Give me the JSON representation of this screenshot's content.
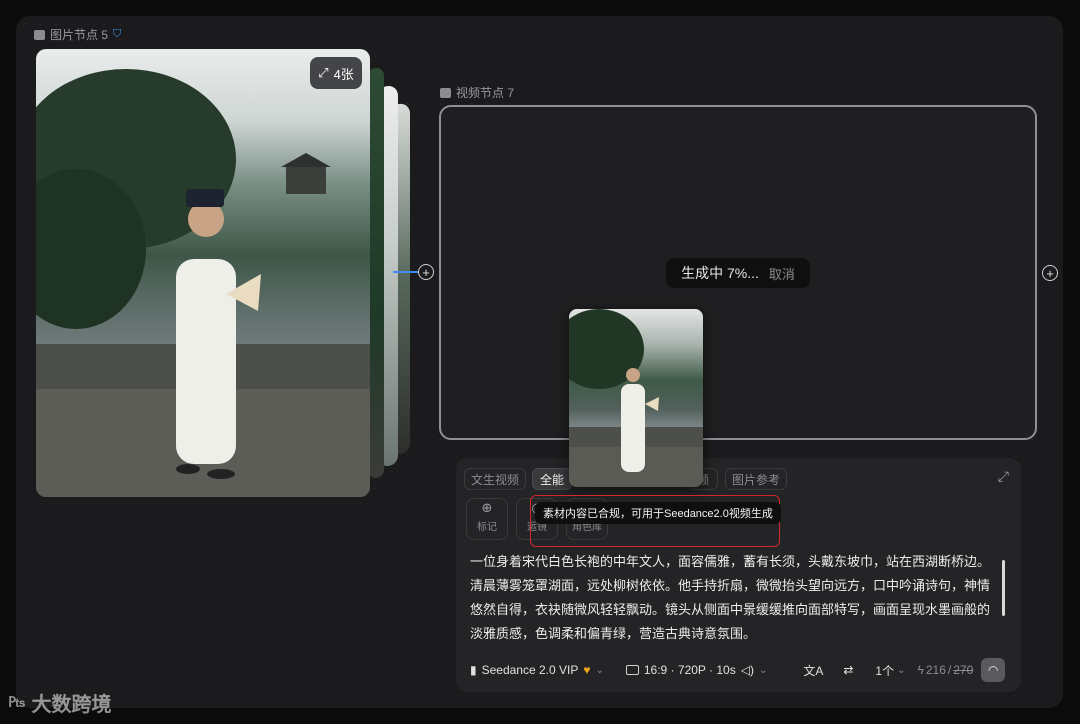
{
  "image_node": {
    "label": "图片节点 5",
    "expand_label": "4张"
  },
  "video_node": {
    "label": "视频节点 7"
  },
  "generation": {
    "status": "生成中 7%...",
    "cancel": "取消"
  },
  "panel": {
    "tabs": [
      "文生视频",
      "全能",
      "频",
      "图片参考"
    ],
    "tools": [
      "标记",
      "运镜",
      "角色库"
    ],
    "tooltip": "素材内容已合规，可用于Seedance2.0视频生成",
    "prompt": "一位身着宋代白色长袍的中年文人，面容儒雅，蓄有长须，头戴东坡巾，站在西湖断桥边。清晨薄雾笼罩湖面，远处柳树依依。他手持折扇，微微抬头望向远方，口中吟诵诗句，神情悠然自得，衣袂随微风轻轻飘动。镜头从侧面中景缓缓推向面部特写，画面呈现水墨画般的淡雅质感，色调柔和偏青绿，营造古典诗意氛围。",
    "model": "Seedance 2.0 VIP",
    "params": "16:9 · 720P · 10s",
    "count": "1个",
    "credits": "216",
    "credits_old": "270"
  },
  "watermark": "大数跨境",
  "colors": {
    "canvas": "#1b1b1d",
    "accent": "#3b8df0",
    "highlight": "#d0282b",
    "vip": "#f0a31f"
  }
}
